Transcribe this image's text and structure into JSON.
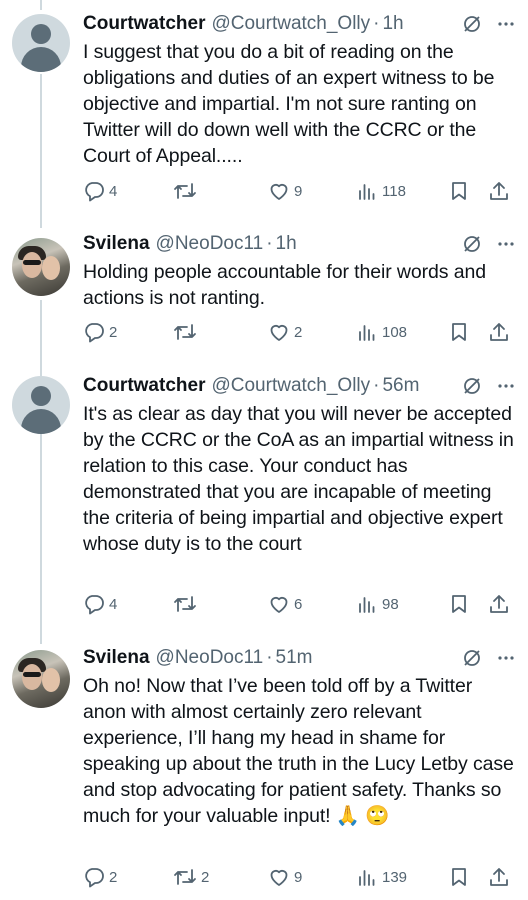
{
  "tweets": [
    {
      "name": "Courtwatcher",
      "handle": "@Courtwatch_Olly",
      "time": "1h",
      "text": "I suggest that you do a bit of reading on the obligations and duties of an expert witness to be objective and impartial. I'm not sure ranting on Twitter will do down well with the CCRC or the Court of Appeal.....",
      "replies": "4",
      "retweets": "",
      "likes": "9",
      "views": "118",
      "avatar": "default-avatar"
    },
    {
      "name": "Svilena",
      "handle": "@NeoDoc11",
      "time": "1h",
      "text": "Holding people accountable for their words and actions is not ranting.",
      "replies": "2",
      "retweets": "",
      "likes": "2",
      "views": "108",
      "avatar": "photo-avatar"
    },
    {
      "name": "Courtwatcher",
      "handle": "@Courtwatch_Olly",
      "time": "56m",
      "text": "It's as clear as day that you will never be accepted by the CCRC or the CoA as an impartial witness in relation to this case. Your conduct has demonstrated that you are incapable of meeting the criteria of being impartial and objective expert whose duty is to the court",
      "replies": "4",
      "retweets": "",
      "likes": "6",
      "views": "98",
      "avatar": "default-avatar"
    },
    {
      "name": "Svilena",
      "handle": "@NeoDoc11",
      "time": "51m",
      "text": "Oh no! Now that I’ve been told off by a Twitter anon with almost certainly zero relevant experience, I’ll hang my head in shame for speaking up about the truth in the Lucy Letby case and stop advocating for patient safety. Thanks so much for your valuable input! 🙏 🙄",
      "replies": "2",
      "retweets": "2",
      "likes": "9",
      "views": "139",
      "avatar": "photo-avatar"
    }
  ],
  "colors": {
    "text": "#0f1419",
    "secondary": "#536471",
    "thread_line": "#cfd9de"
  }
}
